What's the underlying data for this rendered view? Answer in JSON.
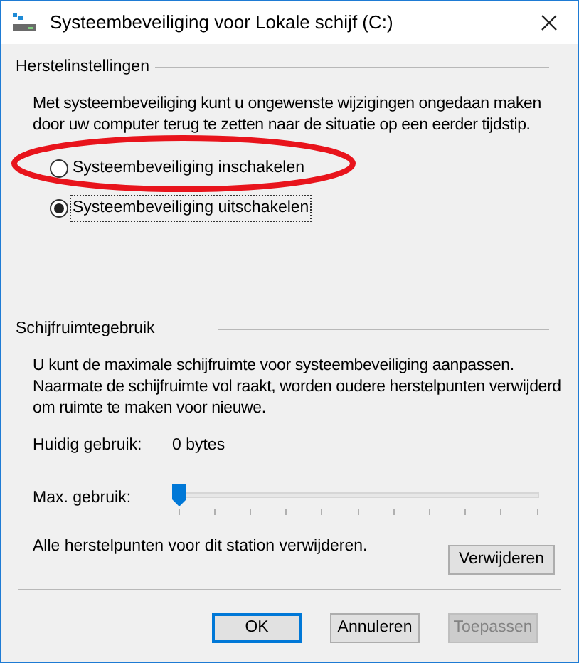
{
  "window": {
    "title": "Systeembeveiliging voor Lokale schijf (C:)"
  },
  "restore_settings": {
    "heading": "Herstelinstellingen",
    "description": "Met systeembeveiliging kunt u ongewenste wijzigingen ongedaan maken door uw computer terug te zetten naar de situatie op een eerder tijdstip.",
    "options": [
      {
        "label": "Systeembeveiliging inschakelen",
        "selected": false,
        "focused": false
      },
      {
        "label": "Systeembeveiliging uitschakelen",
        "selected": true,
        "focused": true
      }
    ]
  },
  "disk_usage": {
    "heading": "Schijfruimtegebruik",
    "description": "U kunt de maximale schijfruimte voor systeembeveiliging aanpassen. Naarmate de schijfruimte vol raakt, worden oudere herstelpunten verwijderd om ruimte te maken voor nieuwe.",
    "current_label": "Huidig gebruik:",
    "current_value": "0 bytes",
    "max_label": "Max. gebruik:",
    "max_slider": {
      "level": 0
    }
  },
  "delete": {
    "text": "Alle herstelpunten voor dit station verwijderen.",
    "button": "Verwijderen"
  },
  "buttons": [
    {
      "label": "OK",
      "default": true,
      "disabled": false
    },
    {
      "label": "Annuleren",
      "default": false,
      "disabled": false
    },
    {
      "label": "Toepassen",
      "default": false,
      "disabled": true
    }
  ]
}
